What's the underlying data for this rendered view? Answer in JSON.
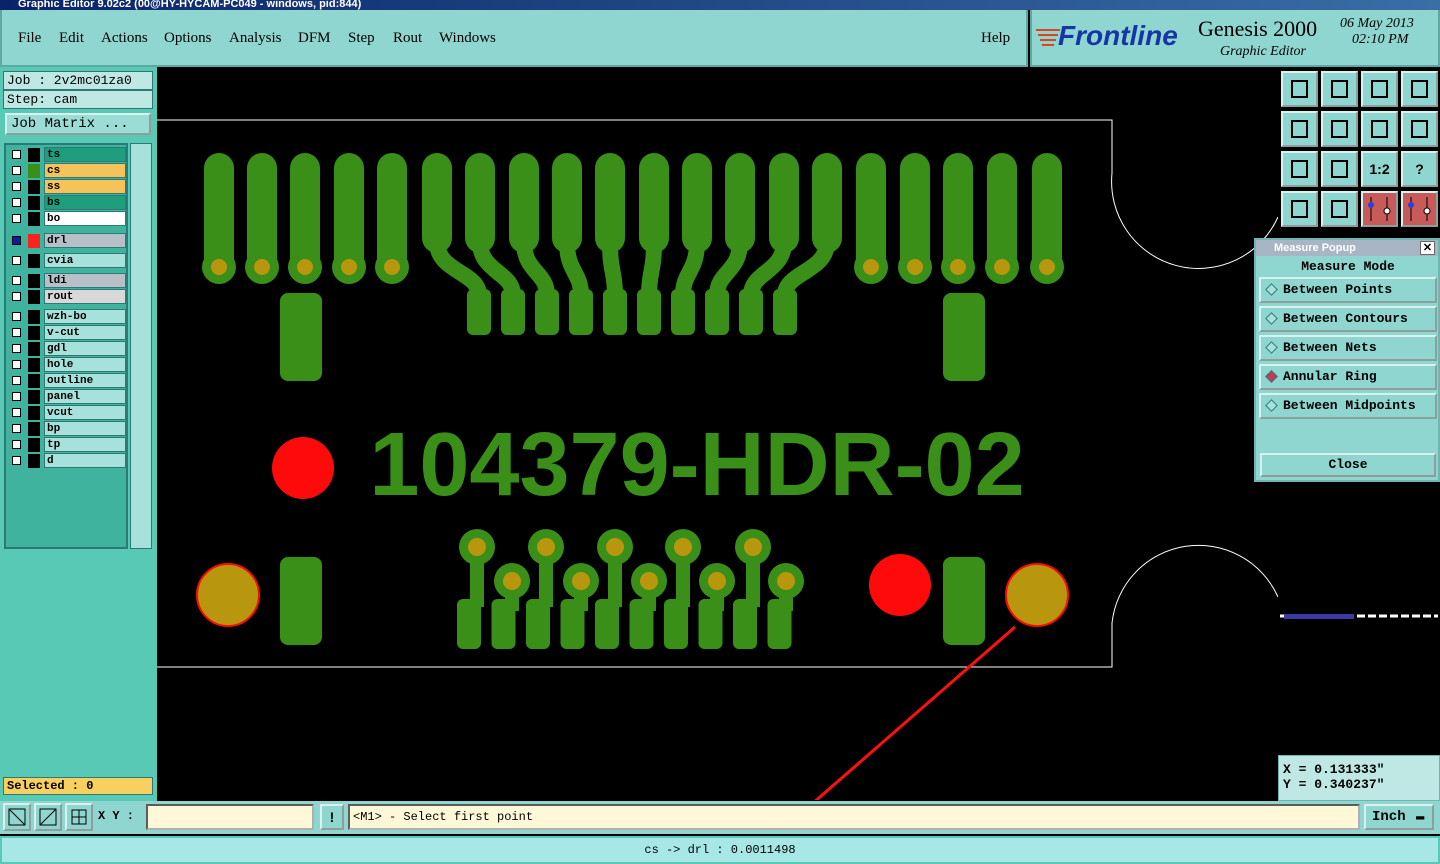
{
  "window": {
    "title": "Graphic Editor 9.02c2 (00@HY-HYCAM-PC049 - windows, pid:844)"
  },
  "menu": {
    "file": "File",
    "edit": "Edit",
    "actions": "Actions",
    "options": "Options",
    "analysis": "Analysis",
    "dfm": "DFM",
    "step": "Step",
    "rout": "Rout",
    "windows": "Windows",
    "help": "Help"
  },
  "brand": {
    "logo": "Frontline",
    "product": "Genesis 2000",
    "subtitle": "Graphic Editor",
    "date": "06 May 2013",
    "time": "02:10 PM"
  },
  "job": {
    "job": "Job : 2v2mc01za0",
    "step": "Step: cam",
    "matrix_button": "Job Matrix ..."
  },
  "layers": [
    {
      "name": "ts",
      "bg": "#1f9e7e",
      "swatch": "#000000"
    },
    {
      "name": "cs",
      "bg": "#f6c25a",
      "swatch": "#3a8f18"
    },
    {
      "name": "ss",
      "bg": "#f6c25a",
      "swatch": "#000000"
    },
    {
      "name": "bs",
      "bg": "#1f9e7e",
      "swatch": "#000000"
    },
    {
      "name": "bo",
      "bg": "#ffffff",
      "swatch": "#000000"
    },
    {
      "name": "drl",
      "bg": "#b7bfc9",
      "swatch": "#ff2020"
    },
    {
      "name": "cvia",
      "bg": "#a7e1db",
      "swatch": "#000000"
    },
    {
      "name": "ldi",
      "bg": "#b7bfc9",
      "swatch": "#000000"
    },
    {
      "name": "rout",
      "bg": "#d8d8d8",
      "swatch": "#000000"
    },
    {
      "name": "wzh-bo",
      "bg": "#a7e1db",
      "swatch": "#000000"
    },
    {
      "name": "v-cut",
      "bg": "#a7e1db",
      "swatch": "#000000"
    },
    {
      "name": "gdl",
      "bg": "#a7e1db",
      "swatch": "#000000"
    },
    {
      "name": "hole",
      "bg": "#a7e1db",
      "swatch": "#000000"
    },
    {
      "name": "outline",
      "bg": "#a7e1db",
      "swatch": "#000000"
    },
    {
      "name": "panel",
      "bg": "#a7e1db",
      "swatch": "#000000"
    },
    {
      "name": "vcut",
      "bg": "#a7e1db",
      "swatch": "#000000"
    },
    {
      "name": "bp",
      "bg": "#a7e1db",
      "swatch": "#000000"
    },
    {
      "name": "tp",
      "bg": "#a7e1db",
      "swatch": "#000000"
    },
    {
      "name": "d",
      "bg": "#a7e1db",
      "swatch": "#000000"
    }
  ],
  "selected": "Selected : 0",
  "board": {
    "label": "104379-HDR-02",
    "copper_color": "#3a8f18",
    "pad_color": "#b8960e",
    "drill_color": "#ff0a0a"
  },
  "measure": {
    "title": "Measure Popup",
    "header": "Measure Mode",
    "options": [
      "Between Points",
      "Between Contours",
      "Between Nets",
      "Annular Ring",
      "Between Midpoints"
    ],
    "selected": "Annular Ring",
    "close": "Close"
  },
  "coords": {
    "x": "X = 0.131333\"",
    "y": "Y = 0.340237\""
  },
  "bottom": {
    "xy_label": "X Y :",
    "excl": "!",
    "prompt": "<M1> - Select first point",
    "units": "Inch"
  },
  "status": "cs -> drl : 0.0011498",
  "toolbar_labels": {
    "ratio": "1:2",
    "help": "?"
  }
}
